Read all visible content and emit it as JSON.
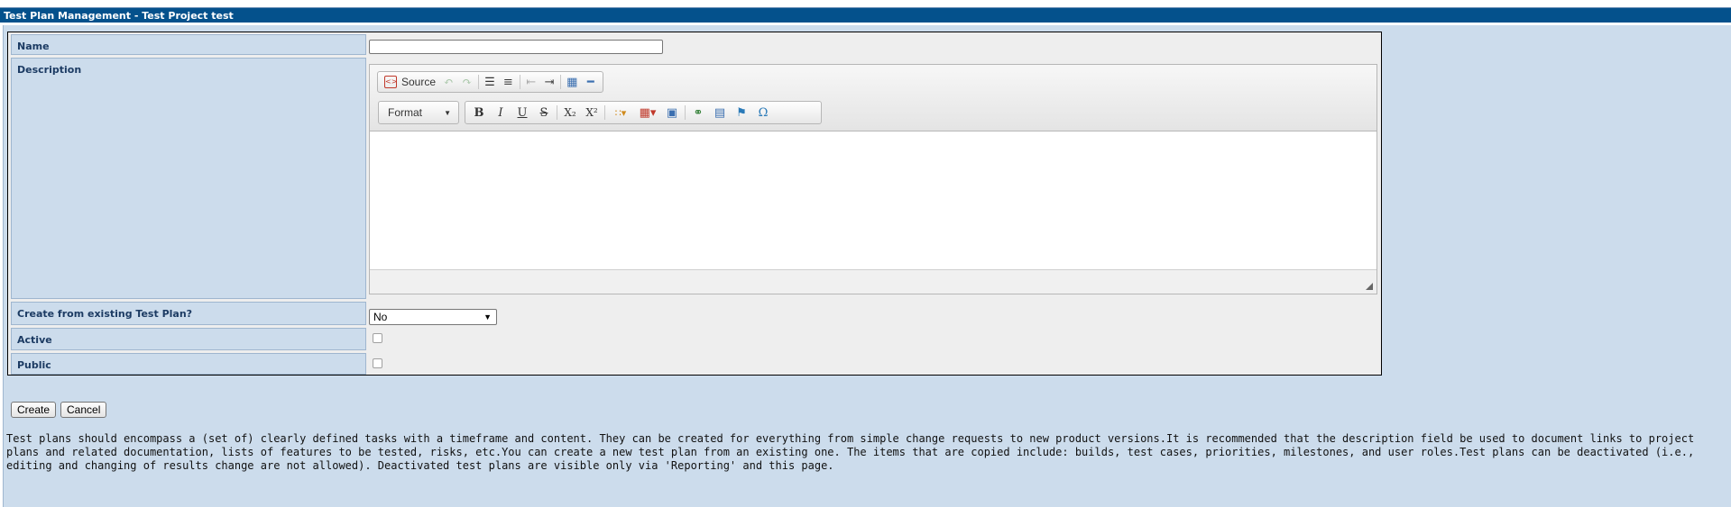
{
  "title": "Test Plan Management - Test Project test",
  "form": {
    "name_label": "Name",
    "name_value": "",
    "description_label": "Description",
    "create_from_label": "Create from existing Test Plan?",
    "create_from_value": "No",
    "active_label": "Active",
    "active_checked": false,
    "public_label": "Public",
    "public_checked": false
  },
  "editor": {
    "source_label": "Source",
    "format_label": "Format",
    "toolbar_icons": [
      "source-icon",
      "undo-icon",
      "redo-icon",
      "numbered-list-icon",
      "bulleted-list-icon",
      "outdent-icon",
      "indent-icon",
      "table-of-contents-icon",
      "horizontal-rule-icon",
      "bold-icon",
      "italic-icon",
      "underline-icon",
      "strikethrough-icon",
      "subscript-icon",
      "superscript-icon",
      "color-icon",
      "table-icon",
      "image-icon",
      "link-icon",
      "insert-icon",
      "flag-icon",
      "special-char-icon"
    ]
  },
  "buttons": {
    "create": "Create",
    "cancel": "Cancel"
  },
  "help_text": "Test plans should encompass a (set of) clearly defined tasks with a timeframe and content. They can be created for everything from simple change requests to new product versions.It is recommended that the description field be used to document links to project plans and related documentation, lists of features to be tested, risks, etc.You can create a new test plan from an existing one. The items that are copied include: builds, test cases, priorities, milestones, and user roles.Test plans can be deactivated (i.e., editing and changing of results change are not allowed). Deactivated test plans are visible only via 'Reporting' and this page."
}
